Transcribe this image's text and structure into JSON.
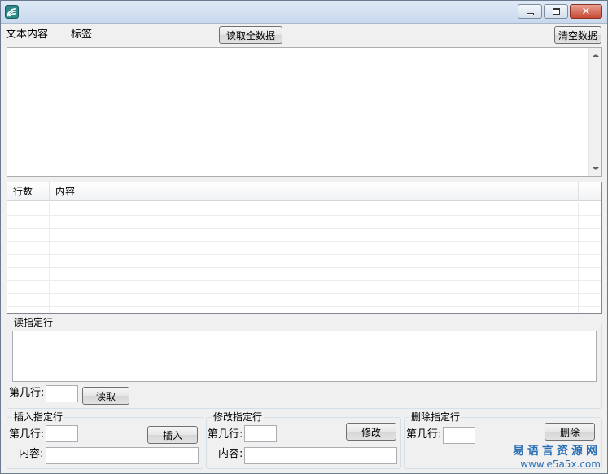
{
  "titlebar": {
    "title": "",
    "buttons": [
      "minimize",
      "maximize",
      "close"
    ]
  },
  "top": {
    "label_text_content": "文本内容",
    "label_tag": "标签",
    "read_all_button": "读取全数据",
    "clear_button": "清空数据"
  },
  "textarea": {
    "value": ""
  },
  "list": {
    "columns": [
      "行数",
      "内容"
    ],
    "rows": []
  },
  "read_group": {
    "title": "读指定行",
    "line_label": "第几行:",
    "line_value": "",
    "read_button": "读取",
    "output": ""
  },
  "insert_group": {
    "title": "插入指定行",
    "line_label": "第几行:",
    "line_value": "",
    "content_label": "内容:",
    "content_value": "",
    "button": "插入"
  },
  "modify_group": {
    "title": "修改指定行",
    "line_label": "第几行:",
    "line_value": "",
    "content_label": "内容:",
    "content_value": "",
    "button": "修改"
  },
  "delete_group": {
    "title": "删除指定行",
    "line_label": "第几行:",
    "line_value": "",
    "button": "删除"
  },
  "watermark": {
    "text": "易语言资源网",
    "url": "www.e5a5x.com"
  },
  "colors": {
    "window_bg": "#f0f0f0",
    "titlebar": "#c9d9ee",
    "close_button": "#c74a36",
    "watermark": "#2a6fb5"
  }
}
